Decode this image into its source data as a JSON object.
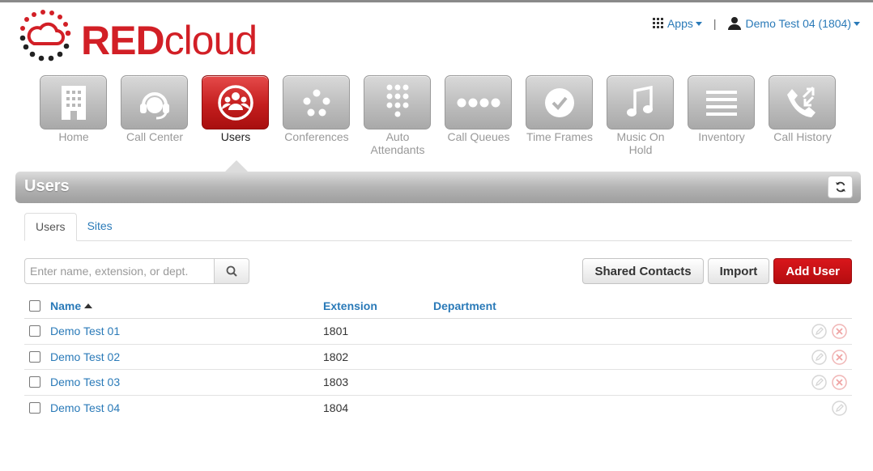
{
  "brand": {
    "logo_bold": "RED",
    "logo_light": "cloud",
    "color": "#d21f26"
  },
  "topbar": {
    "apps_label": "Apps",
    "user_label": "Demo Test 04 (1804)",
    "separator": "|"
  },
  "nav": [
    {
      "label": "Home",
      "icon": "building-icon",
      "active": false
    },
    {
      "label": "Call Center",
      "icon": "headset-icon",
      "active": false
    },
    {
      "label": "Users",
      "icon": "users-icon",
      "active": true
    },
    {
      "label": "Conferences",
      "icon": "conference-icon",
      "active": false
    },
    {
      "label": "Auto Attendants",
      "icon": "keypad-icon",
      "active": false
    },
    {
      "label": "Call Queues",
      "icon": "queue-dots-icon",
      "active": false
    },
    {
      "label": "Time Frames",
      "icon": "clock-icon",
      "active": false
    },
    {
      "label": "Music On Hold",
      "icon": "music-note-icon",
      "active": false
    },
    {
      "label": "Inventory",
      "icon": "list-lines-icon",
      "active": false
    },
    {
      "label": "Call History",
      "icon": "phone-history-icon",
      "active": false
    }
  ],
  "section": {
    "title": "Users"
  },
  "tabs": [
    {
      "label": "Users",
      "active": true
    },
    {
      "label": "Sites",
      "active": false
    }
  ],
  "search": {
    "placeholder": "Enter name, extension, or dept.",
    "value": ""
  },
  "actions": {
    "shared_contacts": "Shared Contacts",
    "import": "Import",
    "add_user": "Add User"
  },
  "table": {
    "columns": {
      "name": "Name",
      "extension": "Extension",
      "department": "Department"
    },
    "sort": {
      "column": "Name",
      "direction": "ascending"
    },
    "rows": [
      {
        "name": "Demo Test 01",
        "extension": "1801",
        "department": "",
        "deletable": true
      },
      {
        "name": "Demo Test 02",
        "extension": "1802",
        "department": "",
        "deletable": true
      },
      {
        "name": "Demo Test 03",
        "extension": "1803",
        "department": "",
        "deletable": true
      },
      {
        "name": "Demo Test 04",
        "extension": "1804",
        "department": "",
        "deletable": false
      }
    ]
  },
  "colors": {
    "accent": "#2a7ab8",
    "danger": "#c8101a",
    "tile_gray": "#b4b4b4"
  }
}
